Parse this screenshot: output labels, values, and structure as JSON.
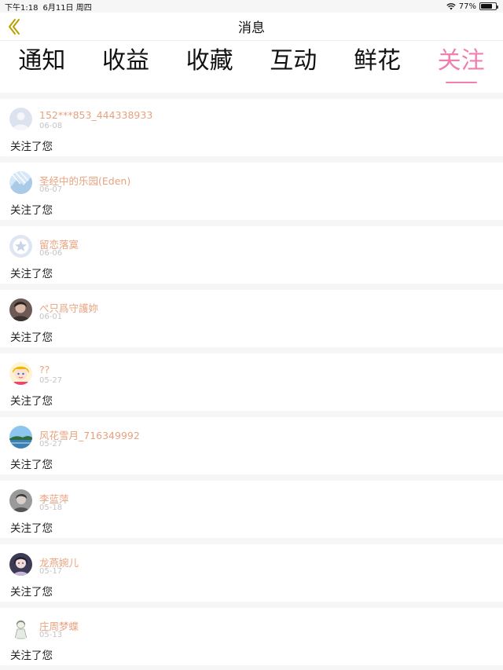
{
  "statusbar": {
    "time": "下午1:18",
    "date": "6月11日 周四",
    "battery": "77%",
    "battery_level": 0.77
  },
  "nav": {
    "title": "消息"
  },
  "tabs": [
    {
      "label": "通知",
      "active": false
    },
    {
      "label": "收益",
      "active": false
    },
    {
      "label": "收藏",
      "active": false
    },
    {
      "label": "互动",
      "active": false
    },
    {
      "label": "鲜花",
      "active": false
    },
    {
      "label": "关注",
      "active": true
    }
  ],
  "colors": {
    "accent": "#ee7fae",
    "username": "#e8a27f",
    "date": "#c4c4c4",
    "back_icon": "#b8a000"
  },
  "follows": [
    {
      "name": "152***853_444338933",
      "date": "06-08",
      "message": "关注了您",
      "avatar": "default-user-avatar"
    },
    {
      "name": "圣经中的乐园(Eden)",
      "date": "06-07",
      "message": "关注了您",
      "avatar": "light-blue-photo-avatar"
    },
    {
      "name": "留恋落寞",
      "date": "06-06",
      "message": "关注了您",
      "avatar": "star-badge-avatar"
    },
    {
      "name": "ぺ只爲守護妳",
      "date": "06-01",
      "message": "关注了您",
      "avatar": "dark-portrait-avatar"
    },
    {
      "name": "??",
      "date": "05-27",
      "message": "关注了您",
      "avatar": "cartoon-girl-avatar"
    },
    {
      "name": "风花雪月_716349992",
      "date": "05-27",
      "message": "关注了您",
      "avatar": "landscape-avatar"
    },
    {
      "name": "李蓝萍",
      "date": "05-18",
      "message": "关注了您",
      "avatar": "grey-portrait-avatar"
    },
    {
      "name": "龙燕婉儿",
      "date": "05-17",
      "message": "关注了您",
      "avatar": "anime-portrait-avatar"
    },
    {
      "name": "庄周梦蝶",
      "date": "05-13",
      "message": "关注了您",
      "avatar": "sketch-figure-avatar"
    }
  ]
}
